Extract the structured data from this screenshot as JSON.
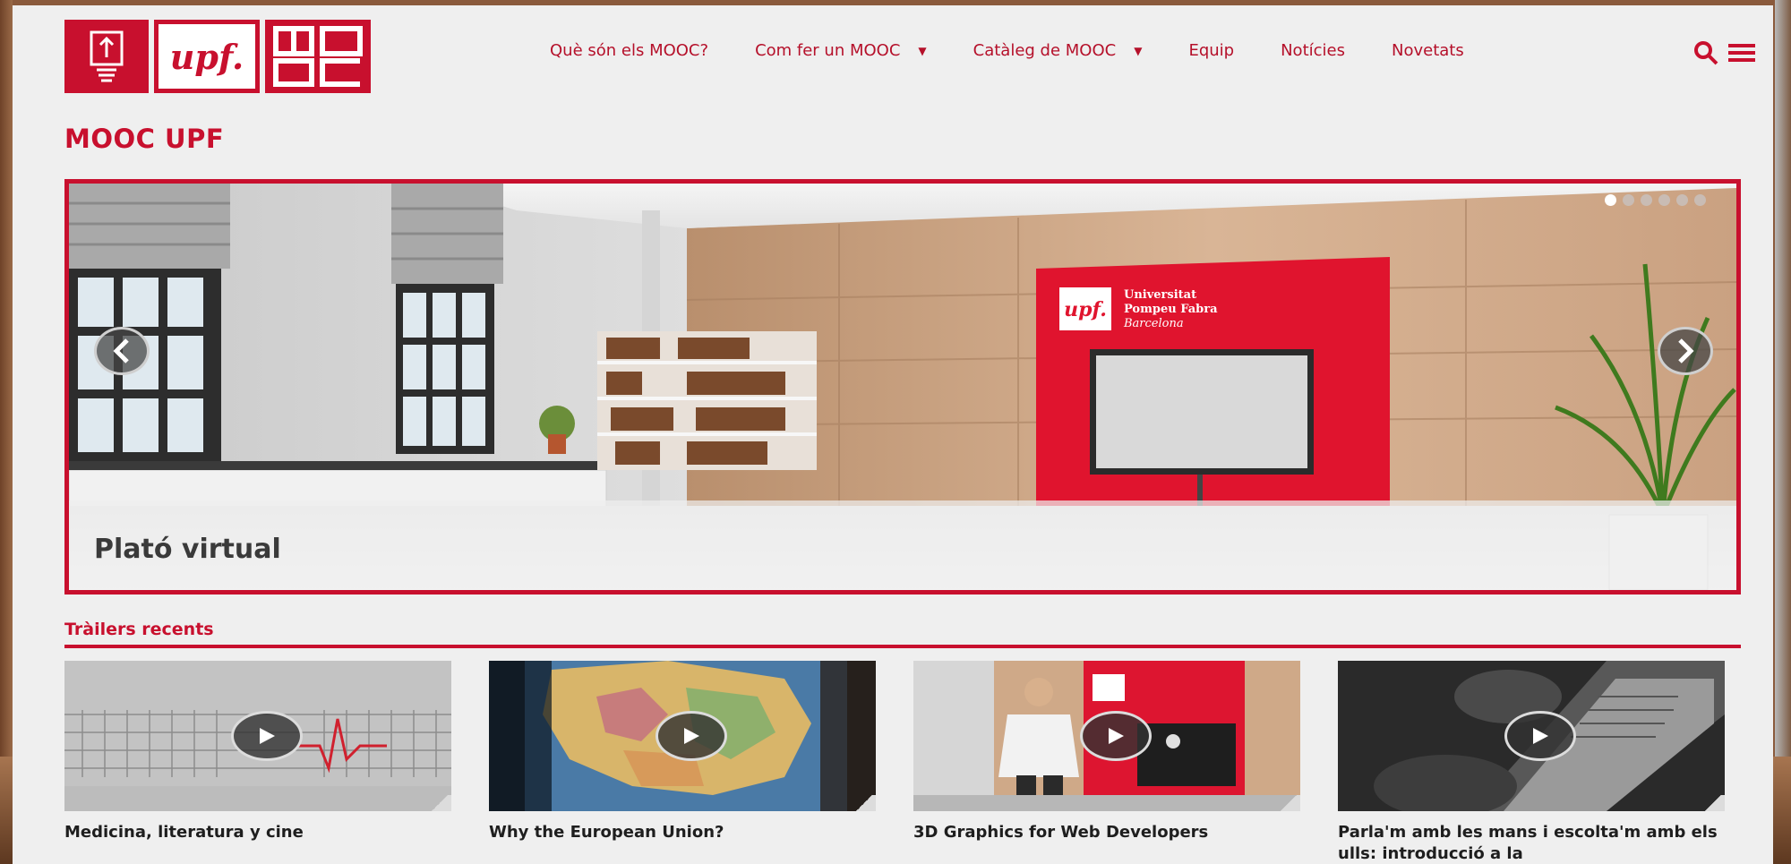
{
  "brand": {
    "upf_logo_text": "upf.",
    "accent": "#c8102e"
  },
  "nav": {
    "items": [
      {
        "label": "Què són els MOOC?",
        "has_dropdown": false
      },
      {
        "label": "Com fer un MOOC",
        "has_dropdown": true
      },
      {
        "label": "Catàleg de MOOC",
        "has_dropdown": true
      },
      {
        "label": "Equip",
        "has_dropdown": false
      },
      {
        "label": "Notícies",
        "has_dropdown": false
      },
      {
        "label": "Novetats",
        "has_dropdown": false
      }
    ],
    "icons": [
      "search-icon",
      "hamburger-menu-icon"
    ]
  },
  "page": {
    "title": "MOOC UPF"
  },
  "carousel": {
    "caption": "Plató virtual",
    "slide_count": 6,
    "active_slide": 1,
    "backdrop_text": [
      "Universitat",
      "Pompeu Fabra",
      "Barcelona"
    ],
    "icons": [
      "chevron-left-icon",
      "chevron-right-icon"
    ]
  },
  "trailers": {
    "section_title": "Tràilers recents",
    "items": [
      {
        "title": "Medicina, literatura y cine"
      },
      {
        "title": "Why the European Union?"
      },
      {
        "title": "3D Graphics for Web Developers"
      },
      {
        "title": "Parla'm amb les mans i escolta'm amb els ulls: introducció a la"
      }
    ]
  }
}
